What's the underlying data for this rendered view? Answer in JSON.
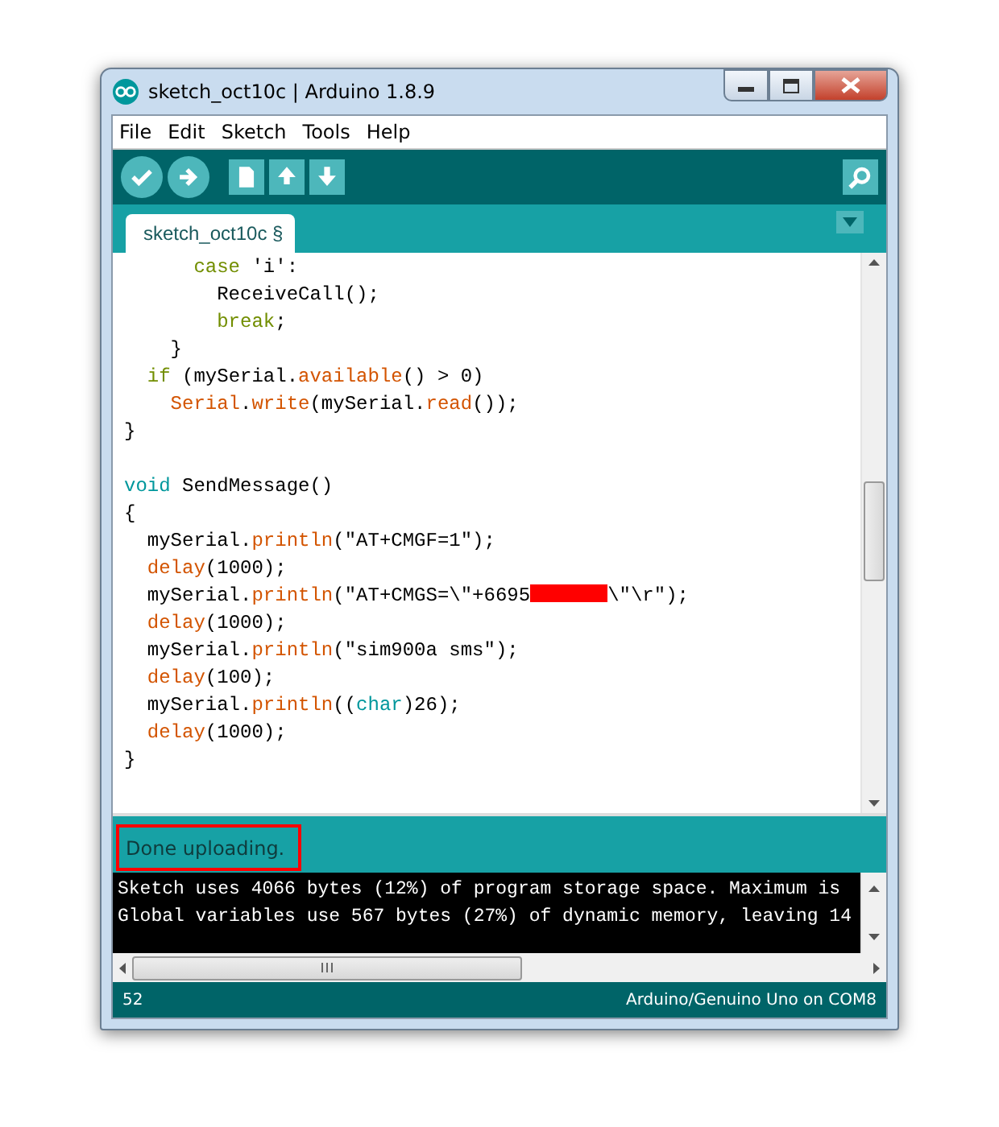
{
  "window": {
    "title": "sketch_oct10c | Arduino 1.8.9"
  },
  "menu": [
    "File",
    "Edit",
    "Sketch",
    "Tools",
    "Help"
  ],
  "tabs": [
    {
      "label": "sketch_oct10c §",
      "selected": true
    }
  ],
  "editor": {
    "lines": [
      [
        {
          "kind": "keyword",
          "text": "      case"
        },
        {
          "kind": "plain",
          "text": " 'i':"
        }
      ],
      [
        {
          "kind": "plain",
          "text": "        ReceiveCall();"
        }
      ],
      [
        {
          "kind": "keyword",
          "text": "        break"
        },
        {
          "kind": "plain",
          "text": ";"
        }
      ],
      [
        {
          "kind": "plain",
          "text": "    }"
        }
      ],
      [
        {
          "kind": "keyword",
          "text": "  if"
        },
        {
          "kind": "plain",
          "text": " (mySerial."
        },
        {
          "kind": "function",
          "text": "available"
        },
        {
          "kind": "plain",
          "text": "() > 0)"
        }
      ],
      [
        {
          "kind": "function",
          "text": "    Serial"
        },
        {
          "kind": "plain",
          "text": "."
        },
        {
          "kind": "function",
          "text": "write"
        },
        {
          "kind": "plain",
          "text": "(mySerial."
        },
        {
          "kind": "function",
          "text": "read"
        },
        {
          "kind": "plain",
          "text": "());"
        }
      ],
      [
        {
          "kind": "plain",
          "text": "}"
        }
      ],
      {
        "kind": "blank"
      },
      [
        {
          "kind": "type",
          "text": "void"
        },
        {
          "kind": "plain",
          "text": " SendMessage()"
        }
      ],
      [
        {
          "kind": "plain",
          "text": "{"
        }
      ],
      [
        {
          "kind": "plain",
          "text": "  mySerial."
        },
        {
          "kind": "function",
          "text": "println"
        },
        {
          "kind": "plain",
          "text": "(\"AT+CMGF=1\");"
        }
      ],
      [
        {
          "kind": "function",
          "text": "  delay"
        },
        {
          "kind": "plain",
          "text": "(1000);"
        }
      ],
      [
        {
          "kind": "plain",
          "text": "  mySerial."
        },
        {
          "kind": "function",
          "text": "println"
        },
        {
          "kind": "plain",
          "text": "(\"AT+CMGS=\\\"+6695"
        },
        {
          "kind": "redaction"
        },
        {
          "kind": "plain",
          "text": "\\\"\\r\");"
        }
      ],
      [
        {
          "kind": "function",
          "text": "  delay"
        },
        {
          "kind": "plain",
          "text": "(1000);"
        }
      ],
      [
        {
          "kind": "plain",
          "text": "  mySerial."
        },
        {
          "kind": "function",
          "text": "println"
        },
        {
          "kind": "plain",
          "text": "(\"sim900a sms\");"
        }
      ],
      [
        {
          "kind": "function",
          "text": "  delay"
        },
        {
          "kind": "plain",
          "text": "(100);"
        }
      ],
      [
        {
          "kind": "plain",
          "text": "  mySerial."
        },
        {
          "kind": "function",
          "text": "println"
        },
        {
          "kind": "plain",
          "text": "(("
        },
        {
          "kind": "type",
          "text": "char"
        },
        {
          "kind": "plain",
          "text": ")26);"
        }
      ],
      [
        {
          "kind": "function",
          "text": "  delay"
        },
        {
          "kind": "plain",
          "text": "(1000);"
        }
      ],
      [
        {
          "kind": "plain",
          "text": "}"
        }
      ]
    ]
  },
  "status": {
    "message": "Done uploading.",
    "highlighted": true
  },
  "console": {
    "lines": [
      "Sketch uses 4066 bytes (12%) of program storage space. Maximum is",
      "Global variables use 567 bytes (27%) of dynamic memory, leaving 14"
    ]
  },
  "status_bar": {
    "line": "52",
    "board": "Arduino/Genuino Uno on COM8"
  }
}
